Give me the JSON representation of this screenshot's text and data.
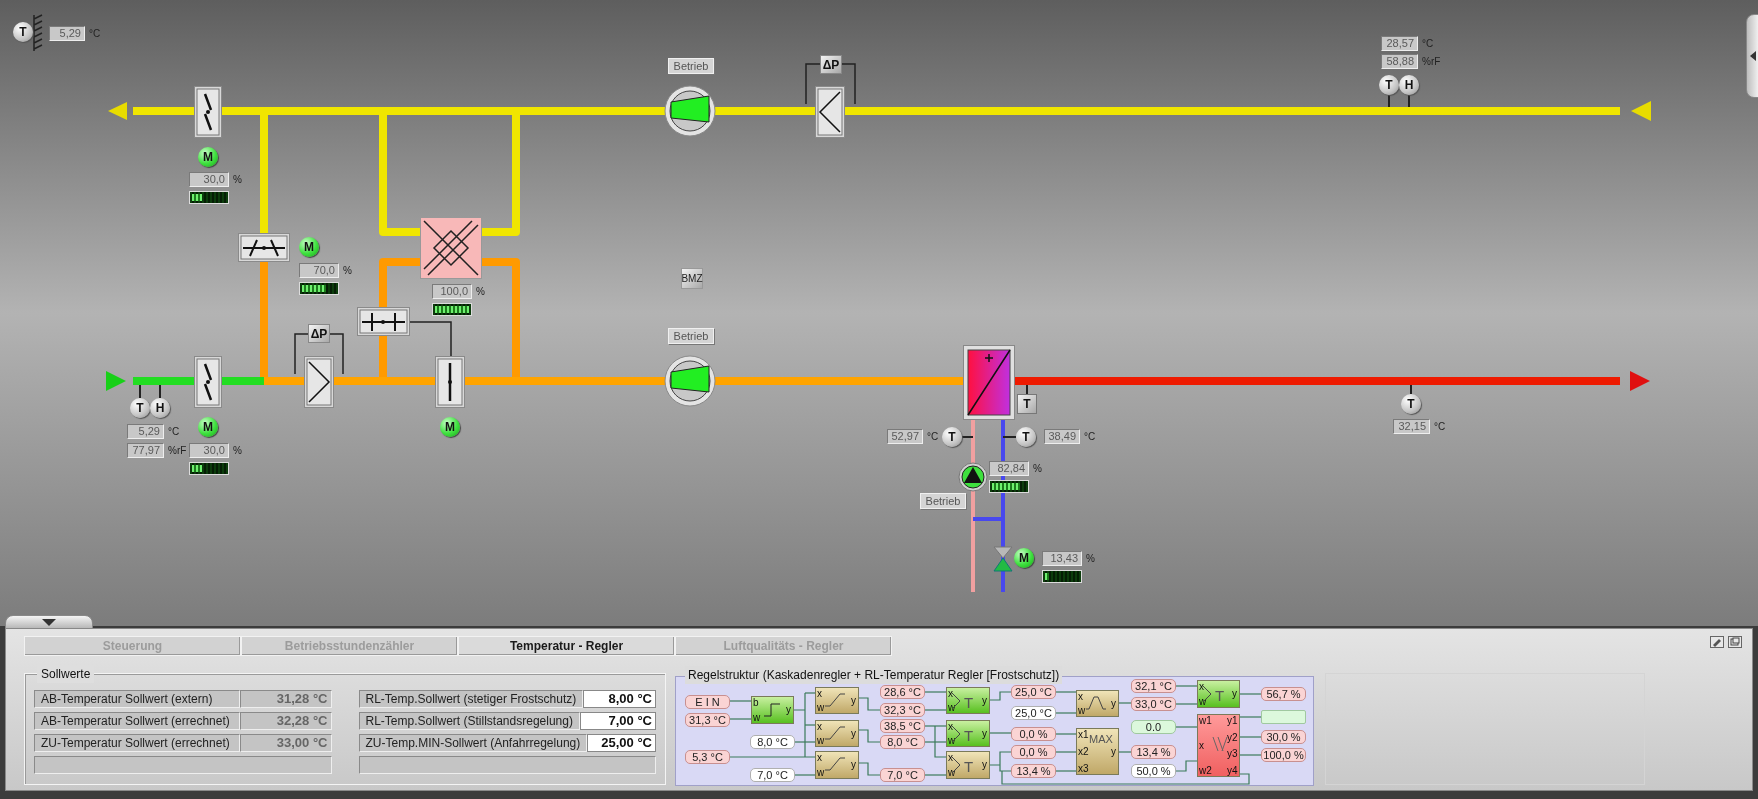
{
  "sensors": [
    {
      "kind": "round",
      "letter": "T"
    },
    {
      "kind": "round",
      "letter": "T"
    },
    {
      "kind": "round",
      "letter": "H"
    },
    {
      "kind": "dp",
      "letter": "ΔP"
    },
    {
      "kind": "dp",
      "letter": "ΔP"
    },
    {
      "kind": "round",
      "letter": "T"
    },
    {
      "kind": "round",
      "letter": "H"
    },
    {
      "kind": "square",
      "letter": "T"
    },
    {
      "kind": "round",
      "letter": "T"
    },
    {
      "kind": "round",
      "letter": "T"
    },
    {
      "kind": "round",
      "letter": "T"
    }
  ],
  "readouts": [
    {
      "value": "5,29",
      "unit": "°C"
    },
    {
      "value": "28,57",
      "unit": "°C"
    },
    {
      "value": "58,88",
      "unit": "%rF"
    },
    {
      "value": "30,0",
      "unit": "%",
      "level": 0.3
    },
    {
      "value": "70,0",
      "unit": "%",
      "level": 0.7
    },
    {
      "value": "100,0",
      "unit": "%",
      "level": 1
    },
    {
      "value": "5,29",
      "unit": "°C"
    },
    {
      "value": "77,97",
      "unit": "%rF"
    },
    {
      "value": "30,0",
      "unit": "%",
      "level": 0.3
    },
    {
      "value": "52,97",
      "unit": "°C"
    },
    {
      "value": "38,49",
      "unit": "°C"
    },
    {
      "value": "82,84",
      "unit": "%",
      "level": 0.83
    },
    {
      "value": "13,43",
      "unit": "%",
      "level": 0.13
    },
    {
      "value": "32,15",
      "unit": "°C"
    }
  ],
  "motors": [
    {
      "letter": "M",
      "running": true
    },
    {
      "letter": "M",
      "running": true
    },
    {
      "letter": "M",
      "running": true
    },
    {
      "letter": "M",
      "running": true
    },
    {
      "letter": "M",
      "running": true
    }
  ],
  "fans": [
    {
      "running": true
    },
    {
      "running": true
    }
  ],
  "pump": {
    "running": true
  },
  "status_labels": [
    "Betrieb",
    "Betrieb",
    "Betrieb"
  ],
  "bmz_button": "BMZ",
  "tabs": [
    {
      "label": "Steuerung",
      "selected": false
    },
    {
      "label": "Betriebsstundenzähler",
      "selected": false
    },
    {
      "label": "Temperatur - Regler",
      "selected": true
    },
    {
      "label": "Luftqualitäts - Regler",
      "selected": false
    }
  ],
  "setpoints": {
    "title": "Sollwerte",
    "left": [
      {
        "label": "AB-Temperatur Sollwert (extern)",
        "value": "31,28 °C"
      },
      {
        "label": "AB-Temperatur Sollwert (errechnet)",
        "value": "32,28 °C"
      },
      {
        "label": "ZU-Temperatur Sollwert (errechnet)",
        "value": "33,00 °C"
      }
    ],
    "right": [
      {
        "label": "RL-Temp.Sollwert (stetiger Frostschutz)",
        "value": "8,00 °C"
      },
      {
        "label": "RL-Temp.Sollwert (Stillstandsregelung)",
        "value": "7,00 °C"
      },
      {
        "label": "ZU-Temp.MIN-Sollwert (Anfahrregelung)",
        "value": "25,00 °C"
      }
    ]
  },
  "control_structure": {
    "title": "Regelstruktur (Kaskadenregler + RL-Temperatur Regler [Frostschutz])",
    "blocks": [
      {
        "kind": "step",
        "active": true,
        "inputs": [
          "b",
          "w"
        ],
        "outputs": [
          "y"
        ]
      },
      {
        "kind": "ramp",
        "active": false,
        "inputs": [
          "x",
          "w"
        ],
        "outputs": [
          "y"
        ]
      },
      {
        "kind": "ramp",
        "active": false,
        "inputs": [
          "x",
          "w"
        ],
        "outputs": [
          "y"
        ]
      },
      {
        "kind": "ramp",
        "active": false,
        "inputs": [
          "x",
          "w"
        ],
        "outputs": [
          "y"
        ]
      },
      {
        "kind": "pid",
        "active": true,
        "inputs": [
          "x",
          "w"
        ],
        "outputs": [
          "y"
        ],
        "symbol": "T"
      },
      {
        "kind": "pid",
        "active": true,
        "inputs": [
          "x",
          "w"
        ],
        "outputs": [
          "y"
        ],
        "symbol": "T"
      },
      {
        "kind": "pid",
        "active": false,
        "inputs": [
          "x",
          "w"
        ],
        "outputs": [
          "y"
        ],
        "symbol": "T"
      },
      {
        "kind": "curve",
        "active": false,
        "inputs": [
          "x",
          "w"
        ],
        "outputs": [
          "y"
        ]
      },
      {
        "kind": "max",
        "active": false,
        "inputs": [
          "x1",
          "x2",
          "x3"
        ],
        "outputs": [
          "y"
        ],
        "symbol": "MAX"
      },
      {
        "kind": "pid",
        "active": true,
        "inputs": [
          "x",
          "w"
        ],
        "outputs": [
          "y"
        ],
        "symbol": "T"
      },
      {
        "kind": "sequence",
        "active": false,
        "inputs": [
          "w1",
          "x",
          "w2"
        ],
        "outputs": [
          "y1",
          "y2",
          "y3",
          "y4"
        ]
      }
    ],
    "values": [
      {
        "text": "E I N",
        "kind": "reading"
      },
      {
        "text": "31,3 °C",
        "kind": "reading"
      },
      {
        "text": "8,0 °C",
        "kind": "param"
      },
      {
        "text": "5,3 °C",
        "kind": "reading"
      },
      {
        "text": "7,0 °C",
        "kind": "param"
      },
      {
        "text": "28,6 °C",
        "kind": "reading"
      },
      {
        "text": "32,3 °C",
        "kind": "reading"
      },
      {
        "text": "38,5 °C",
        "kind": "reading"
      },
      {
        "text": "8,0 °C",
        "kind": "reading"
      },
      {
        "text": "7,0 °C",
        "kind": "reading"
      },
      {
        "text": "25,0 °C",
        "kind": "reading"
      },
      {
        "text": "25,0 °C",
        "kind": "param"
      },
      {
        "text": "0,0 %",
        "kind": "reading"
      },
      {
        "text": "0,0 %",
        "kind": "reading"
      },
      {
        "text": "13,4 %",
        "kind": "reading"
      },
      {
        "text": "32,1 °C",
        "kind": "reading"
      },
      {
        "text": "33,0 °C",
        "kind": "reading"
      },
      {
        "text": "0.0",
        "kind": "neutral"
      },
      {
        "text": "13,4 %",
        "kind": "reading"
      },
      {
        "text": "50,0 %",
        "kind": "param"
      },
      {
        "text": "56,7 %",
        "kind": "reading"
      },
      {
        "text": "30,0 %",
        "kind": "reading"
      },
      {
        "text": "100,0 %",
        "kind": "reading"
      }
    ]
  }
}
